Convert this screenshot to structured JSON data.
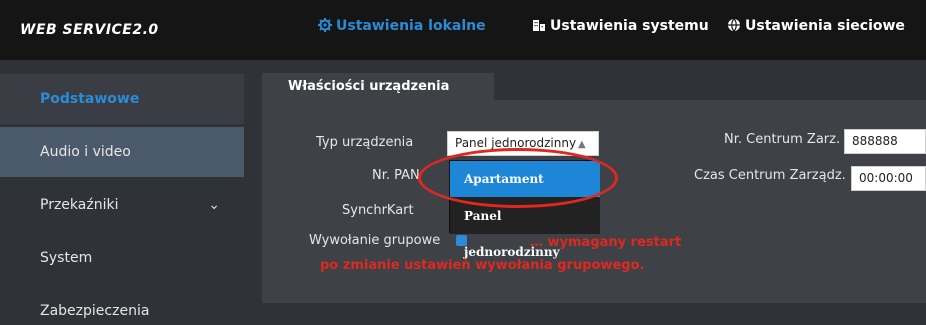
{
  "header": {
    "brand": "WEB SERVICE2.0",
    "nav": [
      {
        "label": "Ustawienia lokalne",
        "icon": "gear-icon",
        "active": true
      },
      {
        "label": "Ustawienia systemu",
        "icon": "building-icon",
        "active": false
      },
      {
        "label": "Ustawienia sieciowe",
        "icon": "globe-icon",
        "active": false
      }
    ]
  },
  "sidebar": {
    "items": [
      {
        "label": "Podstawowe",
        "active": true
      },
      {
        "label": "Audio i video",
        "active": false
      },
      {
        "label": "Przekaźniki",
        "active": false,
        "expandable": true
      },
      {
        "label": "System",
        "active": false
      },
      {
        "label": "Zabezpieczenia",
        "active": false
      }
    ]
  },
  "panel": {
    "tab": "Właściości urządzenia",
    "fields": {
      "typ_label": "Typ urządzenia",
      "typ_value": "Panel jednorodzinny",
      "nrpan_label": "Nr. PAN",
      "synch_label": "SynchrKart",
      "wywolanie_label": "Wywołanie grupowe",
      "centrum_label": "Nr. Centrum Zarz.",
      "centrum_value": "888888",
      "czas_label": "Czas Centrum Zarządz.",
      "czas_value": "00:00:00"
    },
    "dropdown": {
      "options": [
        "Apartament",
        "Panel jednorodzinny"
      ],
      "highlighted": "Apartament"
    },
    "note": {
      "line1": "… wymagany restart",
      "line2": "po zmianie ustawień wywołania grupowego."
    }
  },
  "colors": {
    "accent": "#2b8bd6",
    "highlight_ring": "#e0281f",
    "topbar": "#151515",
    "background": "#2f3236"
  }
}
